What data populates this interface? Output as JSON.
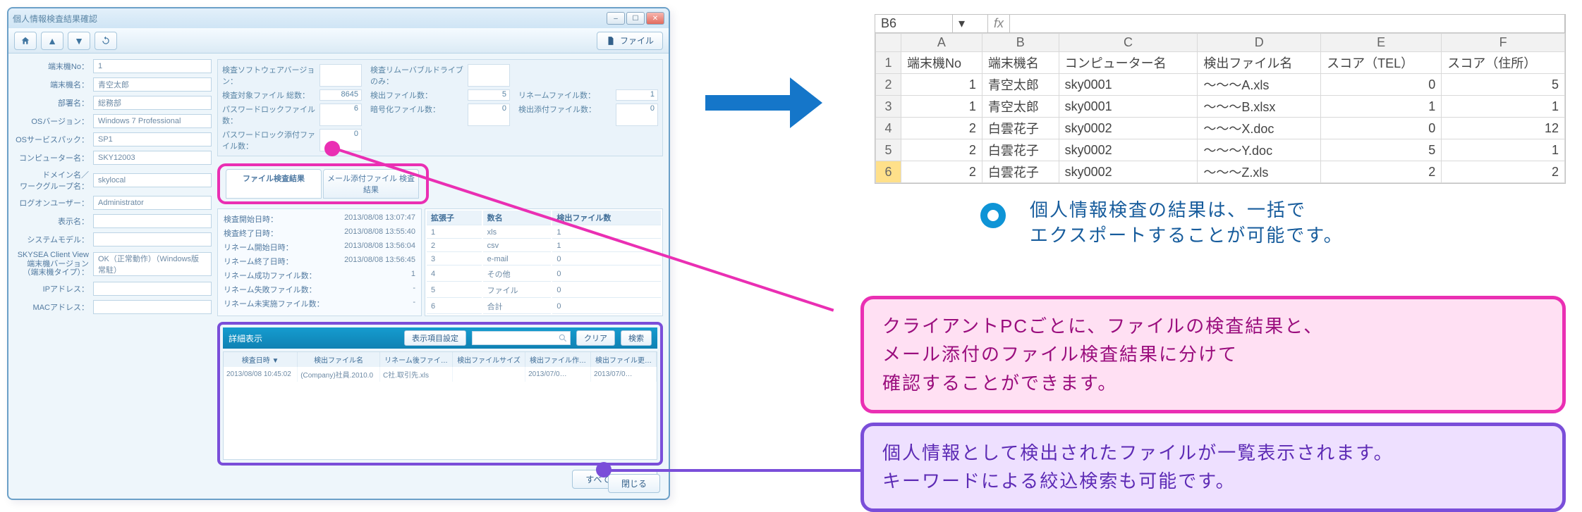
{
  "window": {
    "title": "個人情報検査結果確認",
    "file_btn": "ファイル",
    "close_btn": "閉じる"
  },
  "fields": {
    "f1_label": "端末機No：",
    "f1_value": "1",
    "f2_label": "端末機名：",
    "f2_value": "青空太郎",
    "f3_label": "部署名：",
    "f3_value": "総務部",
    "f4_label": "OSバージョン：",
    "f4_value": "Windows 7 Professional",
    "f5_label": "OSサービスパック：",
    "f5_value": "SP1",
    "f6_label": "コンピューター名：",
    "f6_value": "SKY12003",
    "f7_label": "ドメイン名／\nワークグループ名：",
    "f7_value": "skylocal",
    "f8_label": "ログオンユーザー：",
    "f8_value": "Administrator",
    "f9_label": "表示名：",
    "f9_value": "",
    "f10_label": "システムモデル：",
    "f10_value": "",
    "f11_label": "SKYSEA Client View\n端末機バージョン\n（端末機タイプ）：",
    "f11_value": "OK（正常動作）（Windows版 常駐）",
    "f12_label": "IPアドレス：",
    "f12_value": "",
    "f13_label": "MACアドレス：",
    "f13_value": ""
  },
  "stats": {
    "s1_label": "検査ソフトウェアバージョン：",
    "s1_value": "",
    "s2_label": "検査リムーバブルドライブのみ：",
    "s2_value": "",
    "s3_label": "検査対象ファイル 総数：",
    "s3_value": "8645",
    "s4_label": "検出ファイル数：",
    "s4_value": "5",
    "s5_label": "リネームファイル数：",
    "s5_value": "1",
    "s6_label": "パスワードロックファイル数：",
    "s6_value": "6",
    "s7_label": "暗号化ファイル数：",
    "s7_value": "0",
    "s8_label": "検出添付ファイル数：",
    "s8_value": "0",
    "s9_label": "パスワードロック添付ファイル数：",
    "s9_value": "0"
  },
  "tabs": {
    "t1": "ファイル検査結果",
    "t2": "メール添付ファイル 検査結果"
  },
  "kv": {
    "k1": "検査開始日時：",
    "v1": "2013/08/08 13:07:47",
    "k2": "検査終了日時：",
    "v2": "2013/08/08 13:55:40",
    "k3": "リネーム開始日時：",
    "v3": "2013/08/08 13:56:04",
    "k4": "リネーム終了日時：",
    "v4": "2013/08/08 13:56:45",
    "k5": "リネーム成功ファイル数：",
    "v5": "1",
    "k6": "リネーム失敗ファイル数：",
    "v6": "-",
    "k7": "リネーム未実施ファイル数：",
    "v7": "-"
  },
  "minitab": {
    "h1": "拡張子",
    "h2": "数名",
    "h3": "検出ファイル数",
    "rows": [
      {
        "a": "1",
        "b": "xls",
        "c": "1"
      },
      {
        "a": "2",
        "b": "csv",
        "c": "1"
      },
      {
        "a": "3",
        "b": "e-mail",
        "c": "0"
      },
      {
        "a": "4",
        "b": "その他",
        "c": "0"
      },
      {
        "a": "5",
        "b": "ファイル",
        "c": "0"
      },
      {
        "a": "6",
        "b": "合計",
        "c": "0"
      }
    ]
  },
  "detail": {
    "title": "詳細表示",
    "display_btn": "表示項目設定",
    "clear_btn": "クリア",
    "search_btn": "検索",
    "search_placeholder": "",
    "headers": [
      "検査日時 ▼",
      "検出ファイル名",
      "リネーム後ファイ…",
      "検出ファイルサイズ",
      "検出ファイル作…",
      "検出ファイル更…"
    ],
    "rows": [
      [
        "2013/08/08 10:45:02",
        "(Company)社員.2010.0",
        "C社.取引先.xls",
        "",
        "2013/07/0…",
        "2013/07/0…"
      ]
    ]
  },
  "bottom": {
    "allreset": "すべてリセット"
  },
  "arrow_text": "",
  "sheet": {
    "cellname": "B6",
    "fx": "fx",
    "cols": [
      "",
      "A",
      "B",
      "C",
      "D",
      "E",
      "F"
    ],
    "header": [
      "1",
      "端末機No",
      "端末機名",
      "コンピューター名",
      "検出ファイル名",
      "スコア（TEL）",
      "スコア（住所）"
    ],
    "rows": [
      {
        "rh": "2",
        "c": [
          "1",
          "青空太郎",
          "sky0001",
          "〜〜〜A.xls",
          "0",
          "5"
        ]
      },
      {
        "rh": "3",
        "c": [
          "1",
          "青空太郎",
          "sky0001",
          "〜〜〜B.xlsx",
          "1",
          "1"
        ]
      },
      {
        "rh": "4",
        "c": [
          "2",
          "白雲花子",
          "sky0002",
          "〜〜〜X.doc",
          "0",
          "12"
        ]
      },
      {
        "rh": "5",
        "c": [
          "2",
          "白雲花子",
          "sky0002",
          "〜〜〜Y.doc",
          "5",
          "1"
        ]
      },
      {
        "rh": "6",
        "c": [
          "2",
          "白雲花子",
          "sky0002",
          "〜〜〜Z.xls",
          "2",
          "2"
        ]
      }
    ]
  },
  "note": {
    "line1": "個人情報検査の結果は、一括で",
    "line2": "エクスポートすることが可能です。"
  },
  "callouts": {
    "c1_l1": "クライアントPCごとに、ファイルの検査結果と、",
    "c1_l2": "メール添付のファイル検査結果に分けて",
    "c1_l3": "確認することができます。",
    "c2_l1": "個人情報として検出されたファイルが一覧表示されます。",
    "c2_l2": "キーワードによる絞込検索も可能です。"
  }
}
